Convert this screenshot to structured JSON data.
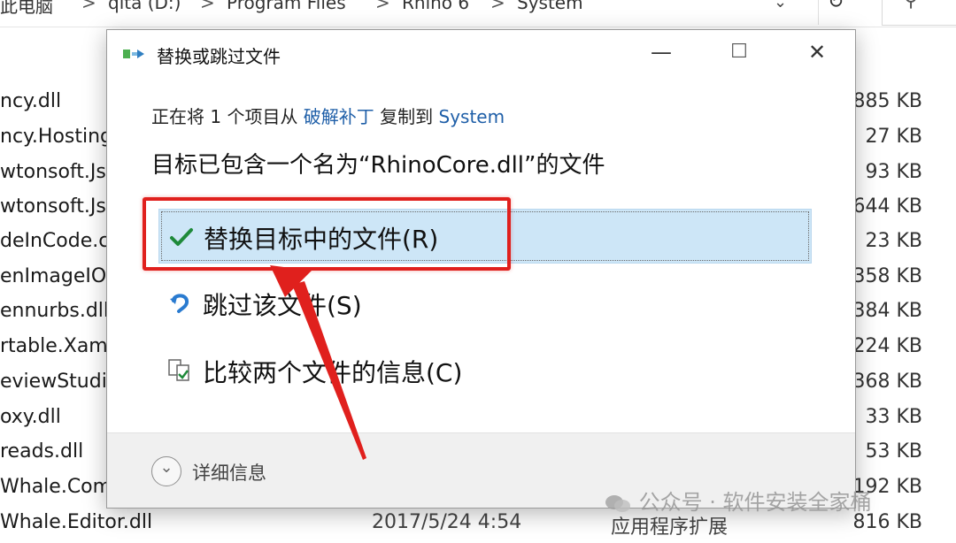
{
  "explorer": {
    "breadcrumbs": [
      "此电脑",
      "qita (D:)",
      "Program Files",
      "Rhino 6",
      "System"
    ],
    "files": [
      {
        "name": "ncy.dll",
        "date": "",
        "type": "",
        "size": "885 KB"
      },
      {
        "name": "ncy.Hosting",
        "date": "",
        "type": "",
        "size": "27 KB"
      },
      {
        "name": "wtonsoft.Js",
        "date": "",
        "type": "",
        "size": "93 KB"
      },
      {
        "name": "wtonsoft.Js",
        "date": "",
        "type": "",
        "size": "644 KB"
      },
      {
        "name": "deInCode.c",
        "date": "",
        "type": "",
        "size": "23 KB"
      },
      {
        "name": "enImageIO",
        "date": "",
        "type": "",
        "size": "358 KB"
      },
      {
        "name": "ennurbs.dll",
        "date": "",
        "type": "",
        "size": "384 KB"
      },
      {
        "name": "rtable.Xaml",
        "date": "",
        "type": "",
        "size": "224 KB"
      },
      {
        "name": "eviewStudio",
        "date": "",
        "type": "",
        "size": "368 KB"
      },
      {
        "name": "oxy.dll",
        "date": "",
        "type": "",
        "size": "33 KB"
      },
      {
        "name": "reads.dll",
        "date": "",
        "type": "",
        "size": "53 KB"
      },
      {
        "name": "Whale.Comm",
        "date": "",
        "type": "",
        "size": "192 KB"
      },
      {
        "name": "Whale.Editor.dll",
        "date": "2017/5/24 4:54",
        "type": "应用程序扩展",
        "size": "816 KB"
      }
    ]
  },
  "dialog": {
    "title": "替换或跳过文件",
    "op_prefix": "正在将 1 个项目从 ",
    "op_source": "破解补丁",
    "op_middle": " 复制到 ",
    "op_dest": "System",
    "heading": "目标已包含一个名为“RhinoCore.dll”的文件",
    "options": [
      {
        "label": "替换目标中的文件(R)",
        "icon": "checkmark-icon",
        "selected": true
      },
      {
        "label": "跳过该文件(S)",
        "icon": "skip-icon",
        "selected": false
      },
      {
        "label": "比较两个文件的信息(C)",
        "icon": "compare-icon",
        "selected": false
      }
    ],
    "more_info": "详细信息"
  },
  "watermark": "公众号 · 软件安装全家桶",
  "colors": {
    "selected_bg": "#cde6f7",
    "link": "#1f5fa8",
    "highlight": "#e0201d",
    "check_green": "#1e8a3a"
  }
}
